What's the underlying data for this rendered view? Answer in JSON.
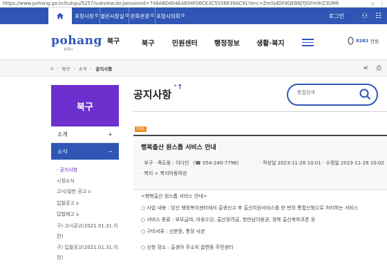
{
  "browser": {
    "url": "https://www.pohang.go.kr/bukgu/5257/subview.do;jsessionid=748ABD404EA694F06CE3C5558839AC91?enc=Zm5jdDF8QEB8JTJGYm9rZ3UlMkYyMw..."
  },
  "topnav": {
    "tabs": [
      "포항시청",
      "열린시장실",
      "문화관광",
      "포항시의회"
    ],
    "login": "로그인"
  },
  "header": {
    "logo_text": "pohang",
    "logo_sub": "포항시",
    "district": "북구",
    "menu": [
      "북구",
      "민원센터",
      "행정정보",
      "생활·복지"
    ],
    "visitor_count": "8282",
    "visitor_unit": "만원"
  },
  "breadcrumb": {
    "items": [
      "북구",
      "소식",
      "공지사항"
    ]
  },
  "sidebar": {
    "title": "북구",
    "menu": [
      {
        "label": "소개",
        "toggle": "+"
      },
      {
        "label": "소식",
        "toggle": "−"
      }
    ],
    "submenu": [
      {
        "label": "· 공지사항",
        "ext": ""
      },
      {
        "label": "시정소식",
        "ext": ""
      },
      {
        "label": "고시/일반 공고",
        "ext": "⧉"
      },
      {
        "label": "입찰공고",
        "ext": "⧉"
      },
      {
        "label": "입법예고",
        "ext": "⧉"
      },
      {
        "label": "구) 고시공고(2021.01.31.이",
        "ext": ""
      },
      {
        "label": "전)",
        "ext": ""
      },
      {
        "label": "구) 입찰공고(2021.01.31.이",
        "ext": ""
      },
      {
        "label": "전)",
        "ext": ""
      }
    ]
  },
  "content": {
    "page_title": "공지사항",
    "search_placeholder": "통합검색",
    "rss": "RSS",
    "article": {
      "title": "행복출산 원스톱 서비스 안내",
      "dept": "· 부구 · 죽도동 : 이다인",
      "phone": "(☎ 054-240-7796)",
      "dates": "· 작성일 2023-11-28 10:01 · 수정일 2023-11-28 10:02",
      "category": "· 복지 > 복지아동여성",
      "body": [
        "<행복출산 원스톱 서비스 안내>",
        "○ 사업 내용 : 임신 행정복지센터에서 출생신고 후 출산지원서비스를 한 번의 통합신청으로 처리하는 서비스",
        "○ 서비스 종류 : 부모급여, 아동수당, 출산장려금, 첫만남이용권, 경북 출산축하쿠폰 등",
        "○ 구비서류 : 신분증, 통장 사본",
        "○ 신청 장소 : 출생아 주소지 읍면동 주민센터"
      ]
    }
  },
  "colors": {
    "primary_blue": "#2f56b5",
    "sidebar_purple": "#6d2fcd",
    "rss_orange": "#f08a25"
  }
}
